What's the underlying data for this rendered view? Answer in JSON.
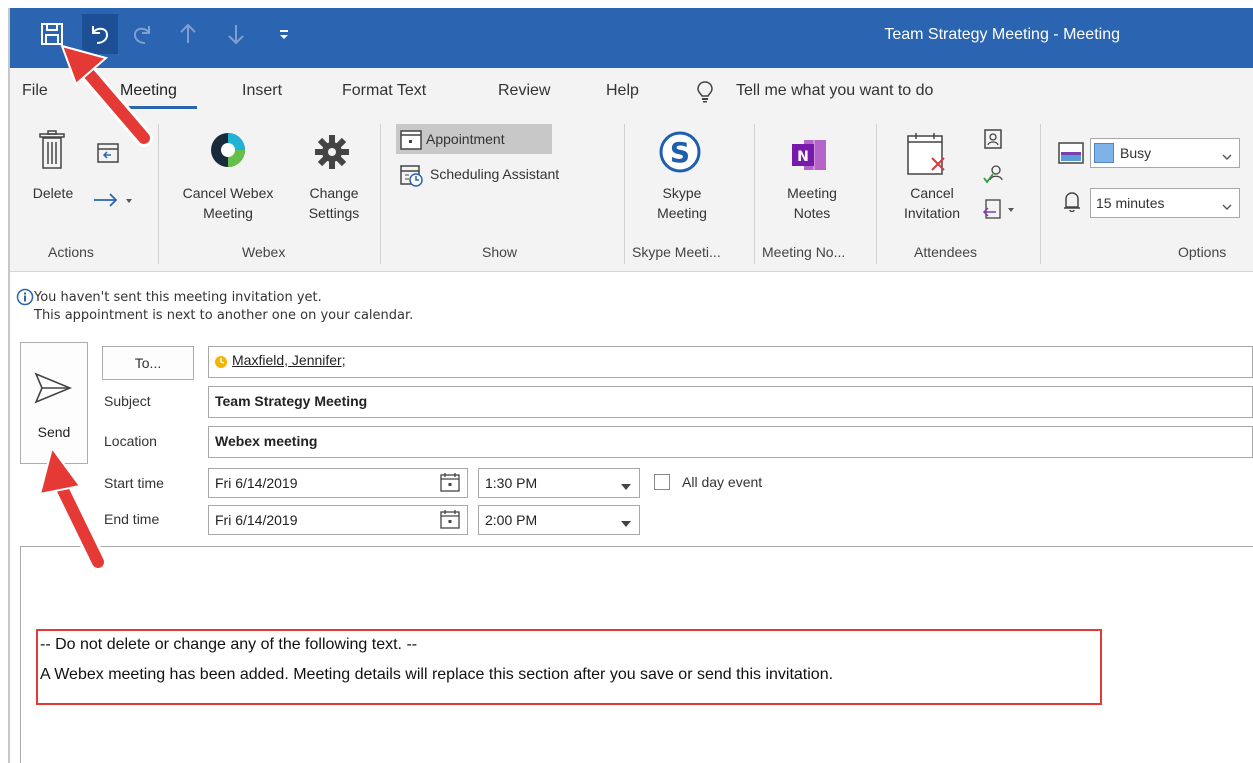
{
  "window": {
    "title": "Team Strategy Meeting  -  Meeting"
  },
  "quick_access": {
    "save_icon": "save-icon",
    "undo_icon": "undo-icon",
    "redo_icon": "redo-icon",
    "up_icon": "arrow-up-icon",
    "down_icon": "arrow-down-icon",
    "more_icon": "customize-toolbar-icon"
  },
  "tabs": [
    {
      "label": "File"
    },
    {
      "label": "Meeting"
    },
    {
      "label": "Insert"
    },
    {
      "label": "Format Text"
    },
    {
      "label": "Review"
    },
    {
      "label": "Help"
    }
  ],
  "tell_me": {
    "label": "Tell me what you want to do"
  },
  "ribbon": {
    "actions": {
      "delete_label": "Delete",
      "group_label": "Actions"
    },
    "webex": {
      "cancel_line1": "Cancel Webex",
      "cancel_line2": "Meeting",
      "change_line1": "Change",
      "change_line2": "Settings",
      "group_label": "Webex"
    },
    "show": {
      "appointment_label": "Appointment",
      "scheduling_label": "Scheduling Assistant",
      "group_label": "Show"
    },
    "skype": {
      "line1": "Skype",
      "line2": "Meeting",
      "group_label": "Skype Meeti..."
    },
    "notes": {
      "line1": "Meeting",
      "line2": "Notes",
      "group_label": "Meeting No..."
    },
    "attendees": {
      "line1": "Cancel",
      "line2": "Invitation",
      "group_label": "Attendees"
    },
    "options": {
      "show_as": "Busy",
      "reminder": "15 minutes",
      "group_label": "Options"
    }
  },
  "infobar": {
    "line1": "You haven't sent this meeting invitation yet.",
    "line2": "This appointment is next to another one on your calendar."
  },
  "form": {
    "send_label": "Send",
    "to_button": "To...",
    "to_value": "Maxfield, Jennifer;",
    "subject_label": "Subject",
    "subject_value": "Team Strategy Meeting",
    "location_label": "Location",
    "location_value": "Webex meeting",
    "start_label": "Start time",
    "start_date": "Fri 6/14/2019",
    "start_time": "1:30 PM",
    "all_day_label": "All day event",
    "end_label": "End time",
    "end_date": "Fri 6/14/2019",
    "end_time": "2:00 PM"
  },
  "body": {
    "line1": "-- Do not delete or change any of the following text. --",
    "line2": "A Webex meeting has been added. Meeting details will replace this section after you save or send this invitation."
  },
  "colors": {
    "titlebar": "#2b64b0",
    "annotation": "#e53935",
    "ribbon": "#f3f3f3"
  }
}
